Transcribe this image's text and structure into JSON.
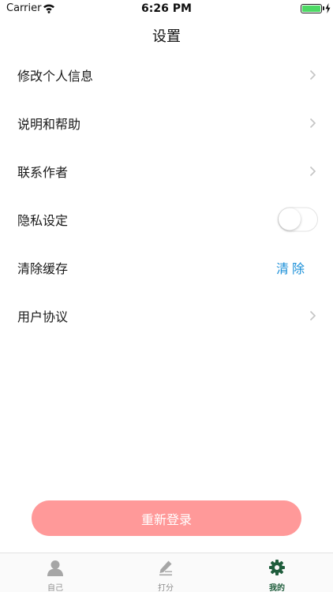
{
  "status_bar": {
    "carrier": "Carrier",
    "time": "6:26 PM",
    "battery_level": 1.0,
    "battery_color": "#4cd964",
    "wifi_icon": "wifi-icon",
    "charging_icon": "bolt-icon"
  },
  "header": {
    "title": "设置"
  },
  "settings": {
    "edit_profile": "修改个人信息",
    "help": "说明和帮助",
    "contact": "联系作者",
    "privacy": "隐私设定",
    "privacy_enabled": false,
    "clear_cache": "清除缓存",
    "clear_action": "清除",
    "user_agreement": "用户协议",
    "chevron_icon": "chevron-right-icon"
  },
  "relogin": {
    "label": "重新登录",
    "color": "#ff9999"
  },
  "tabs": {
    "self": {
      "label": "自己",
      "icon": "person-icon"
    },
    "score": {
      "label": "打分",
      "icon": "pencil-icon"
    },
    "mine": {
      "label": "我的",
      "icon": "gear-icon",
      "active": true
    },
    "active_color": "#1f5d3c",
    "inactive_color": "#8e8e8e"
  }
}
